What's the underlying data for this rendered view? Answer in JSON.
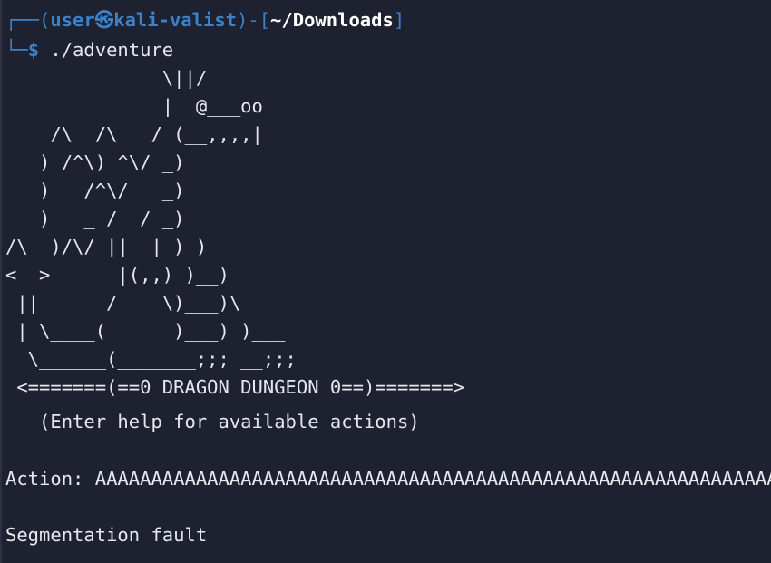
{
  "prompt": {
    "frame_top": "┌──",
    "open_paren": "(",
    "user": "user",
    "at_symbol": "㉿",
    "host": "kali-valist",
    "close_paren": ")",
    "dash": "-",
    "open_bracket": "[",
    "path": "~/Downloads",
    "close_bracket": "]",
    "frame_bottom": "└─",
    "dollar": "$",
    "command": " ./adventure"
  },
  "banner": {
    "art": "              \\||/\n              |  @___oo\n    /\\  /\\   / (__,,,,|\n   ) /^\\) ^\\/ _)\n   )   /^\\/   _)\n   )   _ /  / _)\n/\\  )/\\/ ||  | )_)\n<  >      |(,,) )__)\n ||      /    \\)___)\\\n | \\____(      )___) )___\n  \\______(_______;;; __;;;\n <=======(==0 DRAGON DUNGEON 0==)=======>",
    "hint": "   (Enter help for available actions)"
  },
  "output": {
    "action_line": "Action: AAAAAAAAAAAAAAAAAAAAAAAAAAAAAAAAAAAAAAAAAAAAAAAAAAAAAAAAAAAAA",
    "error": "Segmentation fault"
  },
  "colors": {
    "background": "#1e2230",
    "prompt_blue": "#3b82c9",
    "text": "#e6e8ee"
  }
}
